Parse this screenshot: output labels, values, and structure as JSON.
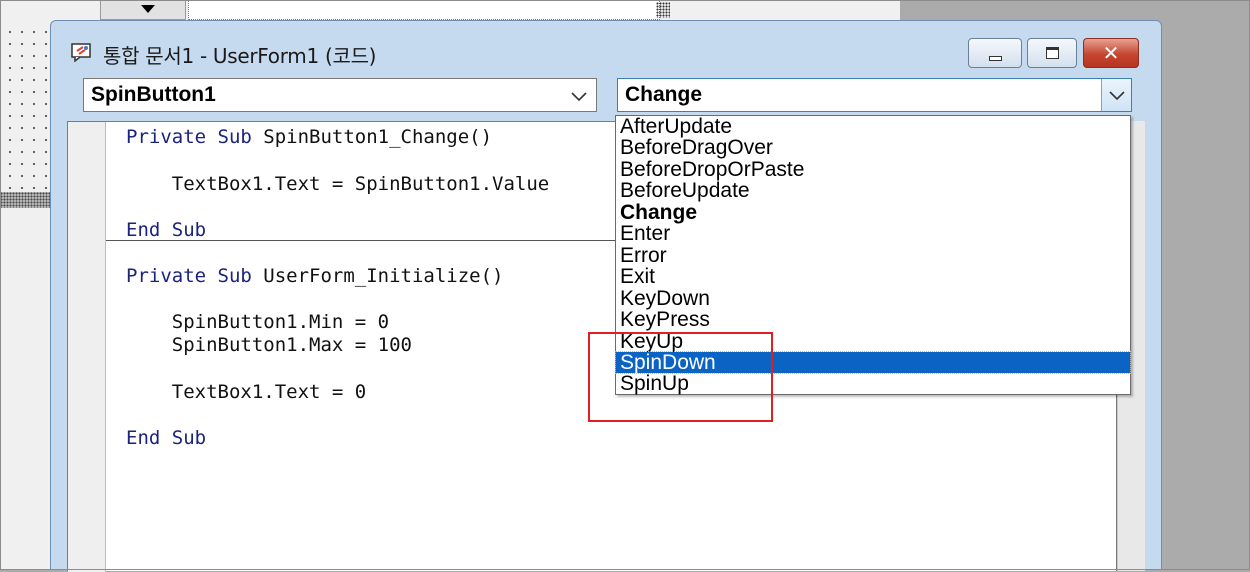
{
  "window": {
    "title": "통합 문서1 - UserForm1 (코드)",
    "icon": "code-window-icon",
    "buttons": {
      "minimize": "minimize-icon",
      "maximize": "maximize-icon",
      "close": "✕"
    }
  },
  "object_combo": {
    "value": "SpinButton1"
  },
  "procedure_combo": {
    "value": "Change"
  },
  "code_lines": [
    {
      "kw1": "Private Sub",
      "rest": " SpinButton1_Change()"
    },
    {
      "kw1": "",
      "rest": "    TextBox1.Text = SpinButton1.Value"
    },
    {
      "kw1": "End Sub",
      "rest": ""
    },
    {
      "kw1": "Private Sub",
      "rest": " UserForm_Initialize()"
    },
    {
      "kw1": "",
      "rest": "    SpinButton1.Min = 0"
    },
    {
      "kw1": "",
      "rest": "    SpinButton1.Max = 100"
    },
    {
      "kw1": "",
      "rest": "    TextBox1.Text = 0"
    },
    {
      "kw1": "End Sub",
      "rest": ""
    }
  ],
  "event_list": [
    "AfterUpdate",
    "BeforeDragOver",
    "BeforeDropOrPaste",
    "BeforeUpdate",
    "Change",
    "Enter",
    "Error",
    "Exit",
    "KeyDown",
    "KeyPress",
    "KeyUp",
    "SpinDown",
    "SpinUp"
  ],
  "event_list_bold": "Change",
  "event_list_selected": "SpinDown",
  "colors": {
    "keyword": "#1a237e",
    "selection": "#0b64c4",
    "annotation": "#e02020"
  }
}
